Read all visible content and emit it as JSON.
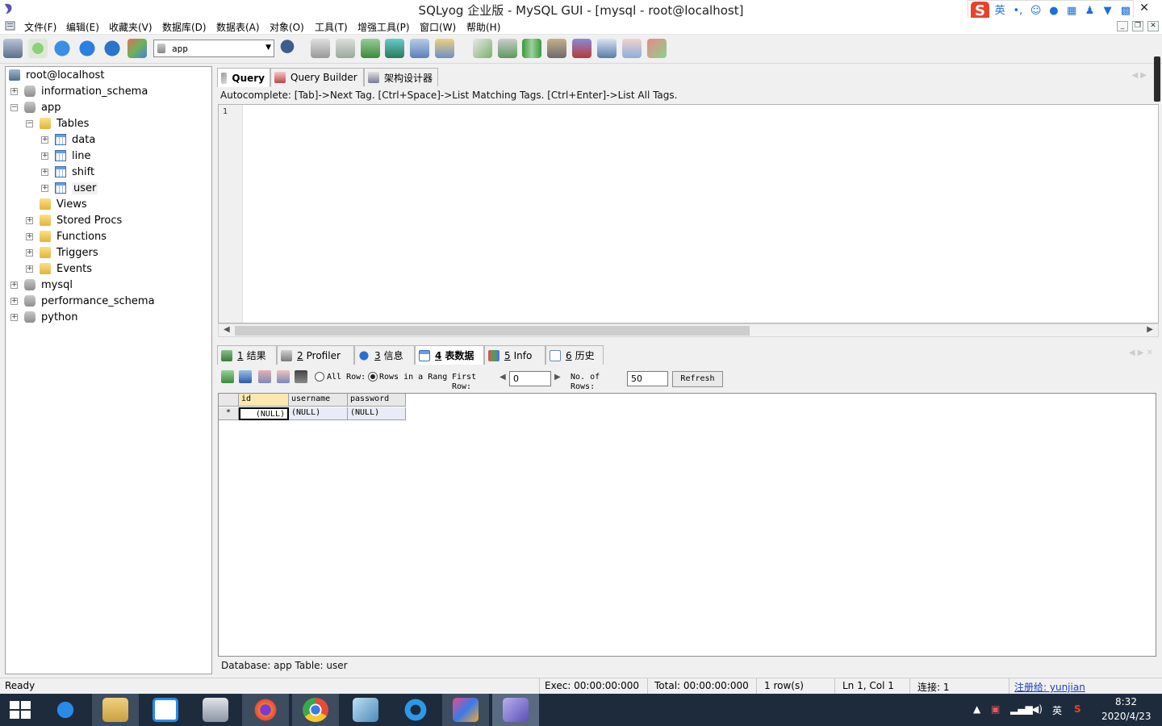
{
  "window": {
    "title": "SQLyog 企业版 - MySQL GUI - [mysql - root@localhost]",
    "close_glyph": "✕",
    "ime": {
      "lang": "英",
      "punct": "•,",
      "items": [
        "emoji-icon",
        "mic-icon",
        "keyboard-icon",
        "user-icon",
        "skin-icon",
        "toolbox-icon"
      ]
    }
  },
  "menu": [
    "文件(F)",
    "编辑(E)",
    "收藏夹(V)",
    "数据库(D)",
    "数据表(A)",
    "对象(O)",
    "工具(T)",
    "增强工具(P)",
    "窗口(W)",
    "帮助(H)"
  ],
  "mdi_controls": [
    "_",
    "❐",
    "✕"
  ],
  "toolbar": {
    "database_select": "app",
    "icons": [
      "new-connection-icon",
      "new-connection-saved-icon",
      "execute-query-icon",
      "execute-all-icon",
      "refresh-icon",
      "sql-tools-icon",
      "user-manager-icon",
      "backup-icon",
      "restore-icon",
      "import-icon",
      "export-icon",
      "copy-db-icon",
      "table-data-icon",
      "table-sync-icon",
      "schema-sync-icon",
      "scheduler-icon",
      "query-builder-icon",
      "visual-data-icon",
      "schema-designer-icon",
      "notifications-icon",
      "migration-icon",
      "structure-icon"
    ]
  },
  "tree": {
    "root": "root@localhost",
    "items": [
      {
        "label": "information_schema",
        "level": 1,
        "type": "db",
        "expander": "+"
      },
      {
        "label": "app",
        "level": 1,
        "type": "db",
        "expander": "−"
      },
      {
        "label": "Tables",
        "level": 2,
        "type": "folder",
        "expander": "−"
      },
      {
        "label": "data",
        "level": 3,
        "type": "table",
        "expander": "+"
      },
      {
        "label": "line",
        "level": 3,
        "type": "table",
        "expander": "+"
      },
      {
        "label": "shift",
        "level": 3,
        "type": "table",
        "expander": "+"
      },
      {
        "label": "user",
        "level": 3,
        "type": "table",
        "expander": "+",
        "selected": true
      },
      {
        "label": "Views",
        "level": 2,
        "type": "folder",
        "expander": ""
      },
      {
        "label": "Stored Procs",
        "level": 2,
        "type": "folder",
        "expander": "+"
      },
      {
        "label": "Functions",
        "level": 2,
        "type": "folder",
        "expander": "+"
      },
      {
        "label": "Triggers",
        "level": 2,
        "type": "folder",
        "expander": "+"
      },
      {
        "label": "Events",
        "level": 2,
        "type": "folder",
        "expander": "+"
      },
      {
        "label": "mysql",
        "level": 1,
        "type": "db",
        "expander": "+"
      },
      {
        "label": "performance_schema",
        "level": 1,
        "type": "db",
        "expander": "+"
      },
      {
        "label": "python",
        "level": 1,
        "type": "db",
        "expander": "+"
      }
    ]
  },
  "query_tabs": [
    {
      "label": "Query",
      "active": true
    },
    {
      "label": "Query Builder",
      "active": false
    },
    {
      "label": "架构设计器",
      "active": false
    }
  ],
  "autocomplete_hint": "Autocomplete: [Tab]->Next Tag. [Ctrl+Space]->List Matching Tags. [Ctrl+Enter]->List All Tags.",
  "editor": {
    "line_number": "1",
    "content": ""
  },
  "result_tabs": [
    {
      "num": "1",
      "label": "结果",
      "active": false
    },
    {
      "num": "2",
      "label": "Profiler",
      "active": false
    },
    {
      "num": "3",
      "label": "信息",
      "active": false
    },
    {
      "num": "4",
      "label": "表数据",
      "active": true
    },
    {
      "num": "5",
      "label": "Info",
      "active": false
    },
    {
      "num": "6",
      "label": "历史",
      "active": false
    }
  ],
  "result_toolbar": {
    "all_rows_label": "All Row:",
    "rows_in_range_label": "Rows in a Rang",
    "first_row_label": [
      "First",
      "Row:"
    ],
    "first_row_value": "0",
    "no_of_rows_label": [
      "No. of",
      "Rows:"
    ],
    "no_of_rows_value": "50",
    "refresh_label": "Refresh"
  },
  "grid": {
    "columns": [
      "id",
      "username",
      "password"
    ],
    "new_row_marker": "*",
    "rows": [
      [
        "(NULL)",
        "(NULL)",
        "(NULL)"
      ]
    ]
  },
  "table_info": "Database: app Table: user",
  "statusbar": {
    "ready": "Ready",
    "exec": "Exec: 00:00:00:000",
    "total": "Total: 00:00:00:000",
    "rows": "1 row(s)",
    "position": "Ln 1, Col 1",
    "connections": "连接: 1",
    "registered": "注册给: yunjian"
  },
  "taskbar": {
    "apps": [
      "windows-start-icon",
      "ie-icon",
      "file-explorer-icon",
      "baidu-netdisk-icon",
      "system-tool-icon",
      "firefox-icon",
      "chrome-icon",
      "notes-icon",
      "browser-icon",
      "intellij-icon",
      "sqlyog-icon"
    ],
    "tray_lang": "英",
    "tray_ime": "S",
    "time": "8:32",
    "date": "2020/4/23"
  }
}
